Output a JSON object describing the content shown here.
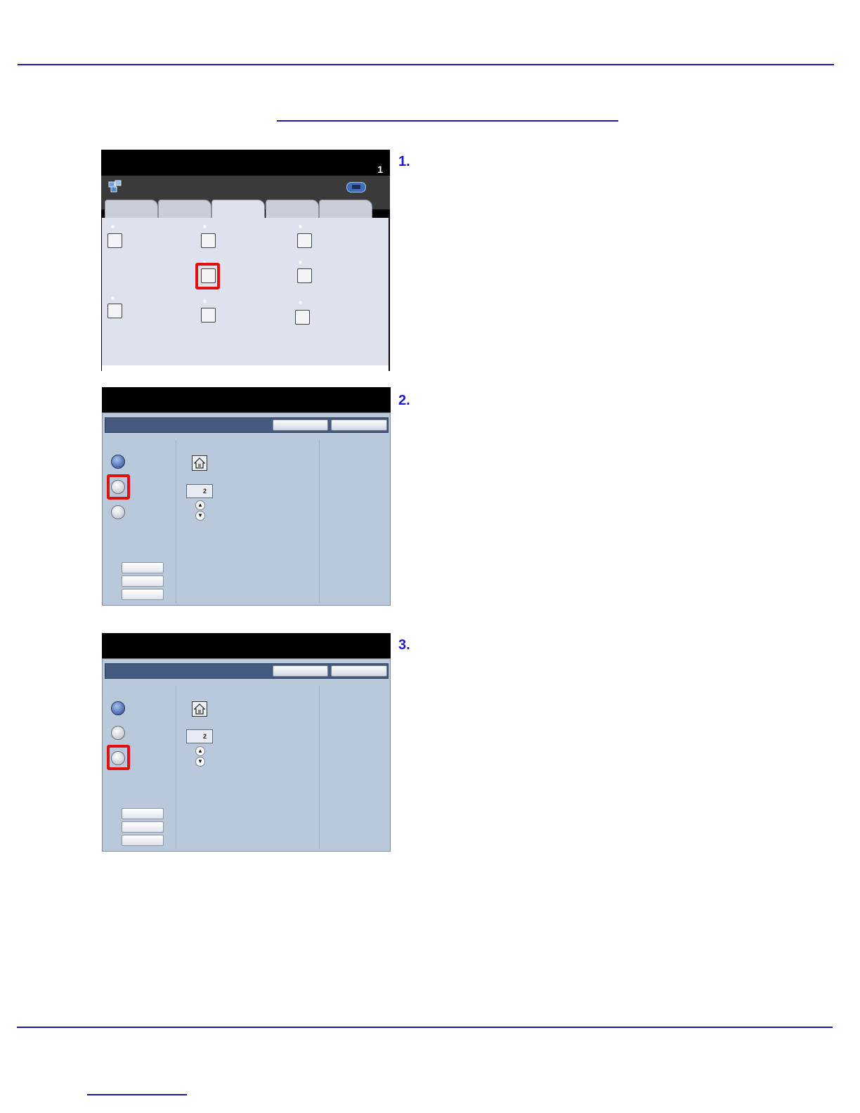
{
  "steps": [
    {
      "number": "1."
    },
    {
      "number": "2."
    },
    {
      "number": "3."
    }
  ],
  "screen1": {
    "counter": "1",
    "icons": {
      "app": "network-app-icon",
      "status": "machine-status-icon"
    }
  },
  "screen2": {
    "quantity_value": "2",
    "spin_up": "▲",
    "spin_down": "▼",
    "icons": {
      "home": "home-icon"
    }
  },
  "screen3": {
    "quantity_value": "2",
    "spin_up": "▲",
    "spin_down": "▼",
    "icons": {
      "home": "home-icon"
    }
  },
  "colors": {
    "rule": "#1a1aa8",
    "highlight": "#e01010",
    "panel": "#b9c8db",
    "step_number": "#1a1ad0"
  }
}
